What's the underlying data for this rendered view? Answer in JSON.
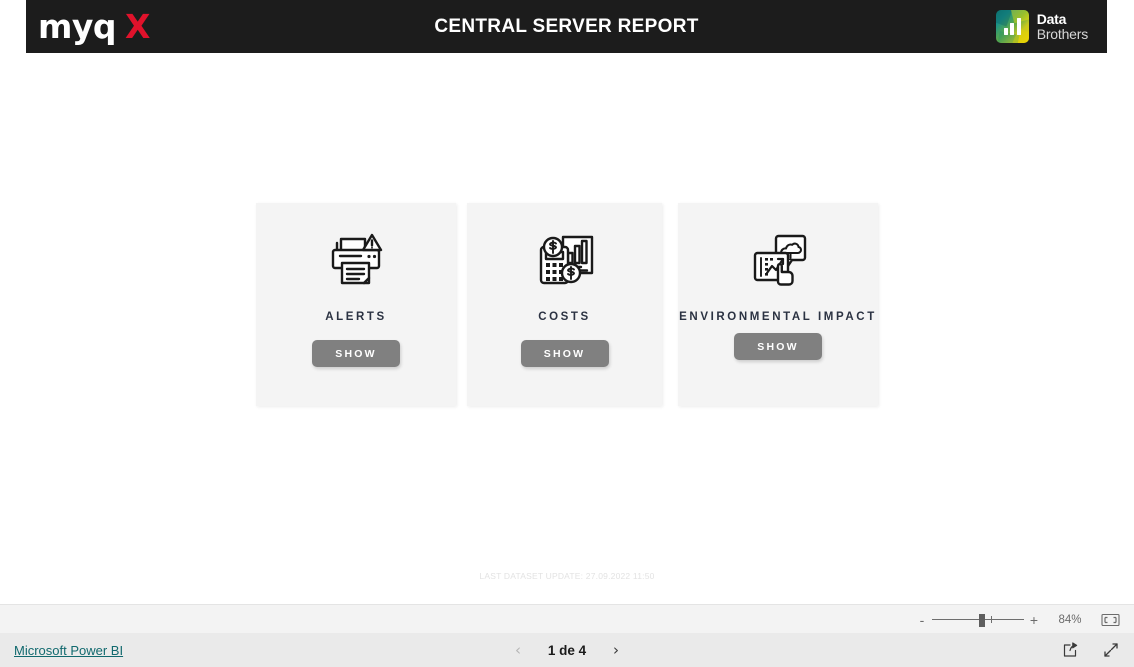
{
  "header": {
    "brand_myq": "myq",
    "brand_x": "X",
    "title": "CENTRAL SERVER REPORT",
    "partner_logo": {
      "icon": "bar-chart-logo-icon",
      "line1": "Data",
      "line2": "Brothers"
    },
    "background_color": "#1c1c1c",
    "accent_red": "#e0122b"
  },
  "cards": [
    {
      "id": "alerts",
      "icon": "printer-alert-icon",
      "label": "ALERTS",
      "button_label": "SHOW"
    },
    {
      "id": "costs",
      "icon": "calculator-money-chart-icon",
      "label": "COSTS",
      "button_label": "SHOW"
    },
    {
      "id": "environmental-impact",
      "icon": "environment-analytics-hand-icon",
      "label": "ENVIRONMENTAL IMPACT",
      "button_label": "SHOW"
    }
  ],
  "footer_note": "LAST DATASET UPDATE: 27.09.2022 11:50",
  "viewer": {
    "zoom": {
      "minus_label": "-",
      "plus_label": "+",
      "value": "84%",
      "fit_icon": "fit-to-page-icon"
    },
    "status": {
      "product_link": "Microsoft Power BI",
      "prev_icon": "chevron-left-icon",
      "next_icon": "chevron-right-icon",
      "page_indicator": "1 de 4",
      "share_icon": "share-icon",
      "fullscreen_icon": "fullscreen-icon"
    },
    "link_color": "#11696e"
  }
}
